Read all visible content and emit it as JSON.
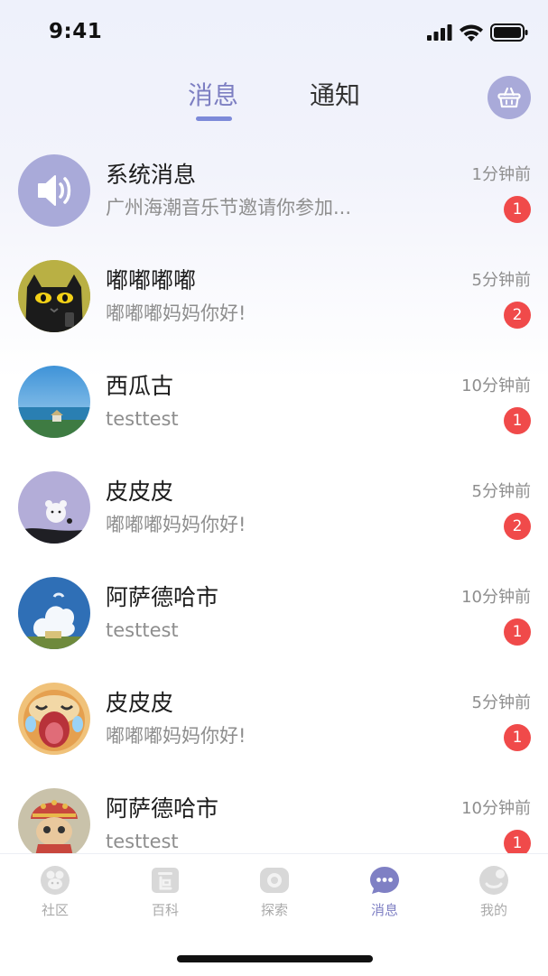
{
  "status_bar": {
    "time": "9:41"
  },
  "header": {
    "tabs": [
      {
        "label": "消息",
        "active": true
      },
      {
        "label": "通知",
        "active": false
      }
    ],
    "basket_icon": "basket-icon"
  },
  "conversations": [
    {
      "name": "系统消息",
      "preview": "广州海潮音乐节邀请你参加...",
      "time": "1分钟前",
      "unread": "1",
      "avatar": "speaker-icon"
    },
    {
      "name": "嘟嘟嘟嘟",
      "preview": "嘟嘟嘟妈妈你好!",
      "time": "5分钟前",
      "unread": "2",
      "avatar": "black-cat-avatar"
    },
    {
      "name": "西瓜古",
      "preview": "testtest",
      "time": "10分钟前",
      "unread": "1",
      "avatar": "sea-landscape-avatar"
    },
    {
      "name": "皮皮皮",
      "preview": "嘟嘟嘟妈妈你好!",
      "time": "5分钟前",
      "unread": "2",
      "avatar": "bear-avatar"
    },
    {
      "name": "阿萨德哈市",
      "preview": "testtest",
      "time": "10分钟前",
      "unread": "1",
      "avatar": "sky-cloud-avatar"
    },
    {
      "name": "皮皮皮",
      "preview": "嘟嘟嘟妈妈你好!",
      "time": "5分钟前",
      "unread": "1",
      "avatar": "crying-dog-avatar"
    },
    {
      "name": "阿萨德哈市",
      "preview": "testtest",
      "time": "10分钟前",
      "unread": "1",
      "avatar": "cat-costume-avatar"
    }
  ],
  "tabbar": {
    "items": [
      {
        "label": "社区",
        "icon": "community-icon",
        "active": false
      },
      {
        "label": "百科",
        "icon": "encyclopedia-icon",
        "active": false
      },
      {
        "label": "探索",
        "icon": "explore-icon",
        "active": false
      },
      {
        "label": "消息",
        "icon": "message-icon",
        "active": true
      },
      {
        "label": "我的",
        "icon": "profile-icon",
        "active": false
      }
    ]
  },
  "colors": {
    "accent": "#7d7fc2",
    "badge": "#f04a4a",
    "avatar_purple": "#a9aad9"
  }
}
